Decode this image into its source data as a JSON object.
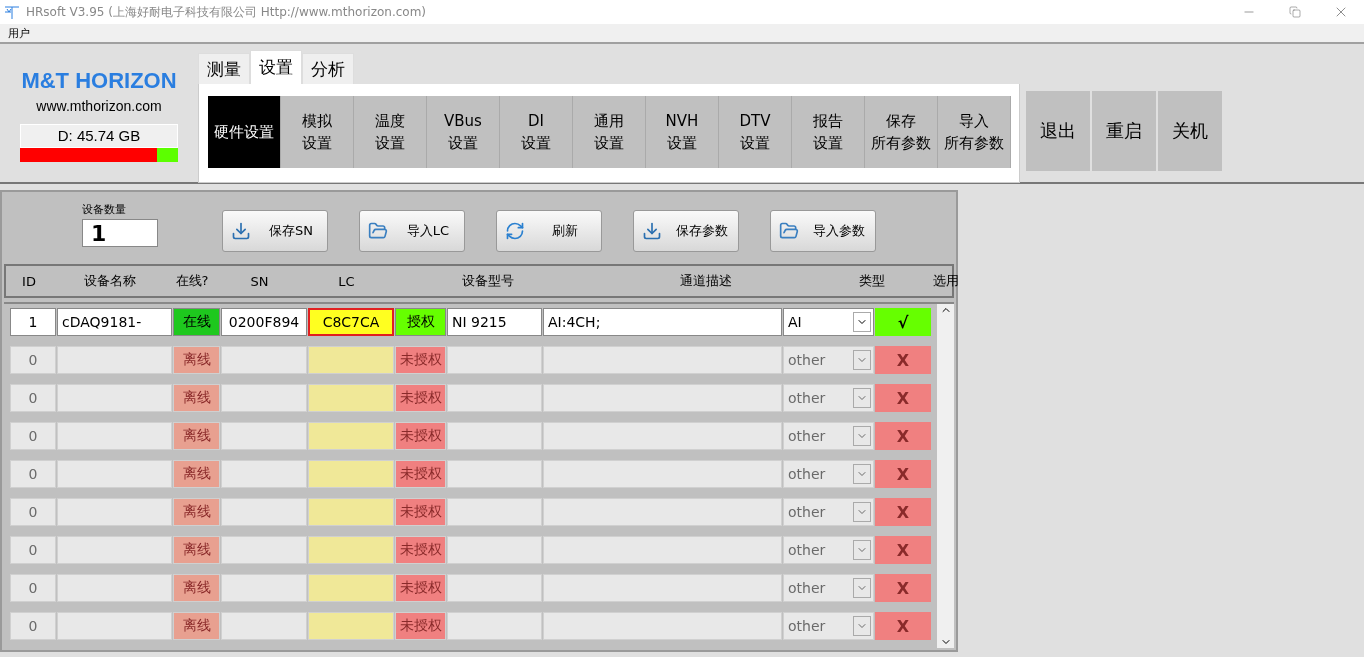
{
  "window": {
    "title": "HRsoft  V3.95 (上海好耐电子科技有限公司 Http://www.mthorizon.com)"
  },
  "menu": [
    "用户"
  ],
  "brand": {
    "name": "M&T HORIZON",
    "url": "www.mthorizon.com",
    "disk": {
      "label": "D:  45.74 GB",
      "level": 0.87
    }
  },
  "tabs": [
    {
      "label": "测量",
      "selected": false
    },
    {
      "label": "设置",
      "selected": true
    },
    {
      "label": "分析",
      "selected": false
    }
  ],
  "subtabs": [
    {
      "lines": [
        "硬件设置"
      ],
      "selected": true
    },
    {
      "lines": [
        "模拟",
        "设置"
      ],
      "selected": false
    },
    {
      "lines": [
        "温度",
        "设置"
      ],
      "selected": false
    },
    {
      "lines": [
        "VBus",
        "设置"
      ],
      "selected": false
    },
    {
      "lines": [
        "DI",
        "设置"
      ],
      "selected": false
    },
    {
      "lines": [
        "通用",
        "设置"
      ],
      "selected": false
    },
    {
      "lines": [
        "NVH",
        "设置"
      ],
      "selected": false
    },
    {
      "lines": [
        "DTV",
        "设置"
      ],
      "selected": false
    },
    {
      "lines": [
        "报告",
        "设置"
      ],
      "selected": false
    },
    {
      "lines": [
        "保存",
        "所有参数"
      ],
      "selected": false
    },
    {
      "lines": [
        "导入",
        "所有参数"
      ],
      "selected": false
    }
  ],
  "system_buttons": [
    "退出",
    "重启",
    "关机"
  ],
  "device_count": {
    "label": "设备数量",
    "value": "1"
  },
  "toolbar": [
    {
      "label": "保存SN",
      "kind": "save"
    },
    {
      "label": "导入LC",
      "kind": "open"
    },
    {
      "label": "刷新",
      "kind": "refresh"
    },
    {
      "label": "保存参数",
      "kind": "save"
    },
    {
      "label": "导入参数",
      "kind": "open"
    }
  ],
  "table": {
    "columns": [
      "ID",
      "设备名称",
      "在线?",
      "SN",
      "LC",
      "设备型号",
      "通道描述",
      "类型",
      "选用"
    ],
    "rows": [
      {
        "id": "1",
        "name": "cDAQ9181-",
        "status": "在线",
        "online": true,
        "sn": "0200F894",
        "lc": "C8C7CA",
        "lc_focused": true,
        "license": "授权",
        "licensed": true,
        "model": "NI 9215",
        "channels": "AI:4CH;",
        "type": "AI",
        "pick": "√",
        "selected": true,
        "disabled": false
      },
      {
        "id": "0",
        "status": "离线",
        "online": false,
        "license": "未授权",
        "licensed": false,
        "type": "other",
        "pick": "X",
        "selected": false,
        "disabled": true,
        "lc_focused": false
      },
      {
        "id": "0",
        "status": "离线",
        "online": false,
        "license": "未授权",
        "licensed": false,
        "type": "other",
        "pick": "X",
        "selected": false,
        "disabled": true,
        "lc_focused": false
      },
      {
        "id": "0",
        "status": "离线",
        "online": false,
        "license": "未授权",
        "licensed": false,
        "type": "other",
        "pick": "X",
        "selected": false,
        "disabled": true,
        "lc_focused": false
      },
      {
        "id": "0",
        "status": "离线",
        "online": false,
        "license": "未授权",
        "licensed": false,
        "type": "other",
        "pick": "X",
        "selected": false,
        "disabled": true,
        "lc_focused": false
      },
      {
        "id": "0",
        "status": "离线",
        "online": false,
        "license": "未授权",
        "licensed": false,
        "type": "other",
        "pick": "X",
        "selected": false,
        "disabled": true,
        "lc_focused": false
      },
      {
        "id": "0",
        "status": "离线",
        "online": false,
        "license": "未授权",
        "licensed": false,
        "type": "other",
        "pick": "X",
        "selected": false,
        "disabled": true,
        "lc_focused": false
      },
      {
        "id": "0",
        "status": "离线",
        "online": false,
        "license": "未授权",
        "licensed": false,
        "type": "other",
        "pick": "X",
        "selected": false,
        "disabled": true,
        "lc_focused": false
      },
      {
        "id": "0",
        "status": "离线",
        "online": false,
        "license": "未授权",
        "licensed": false,
        "type": "other",
        "pick": "X",
        "selected": false,
        "disabled": true,
        "lc_focused": false
      }
    ]
  }
}
